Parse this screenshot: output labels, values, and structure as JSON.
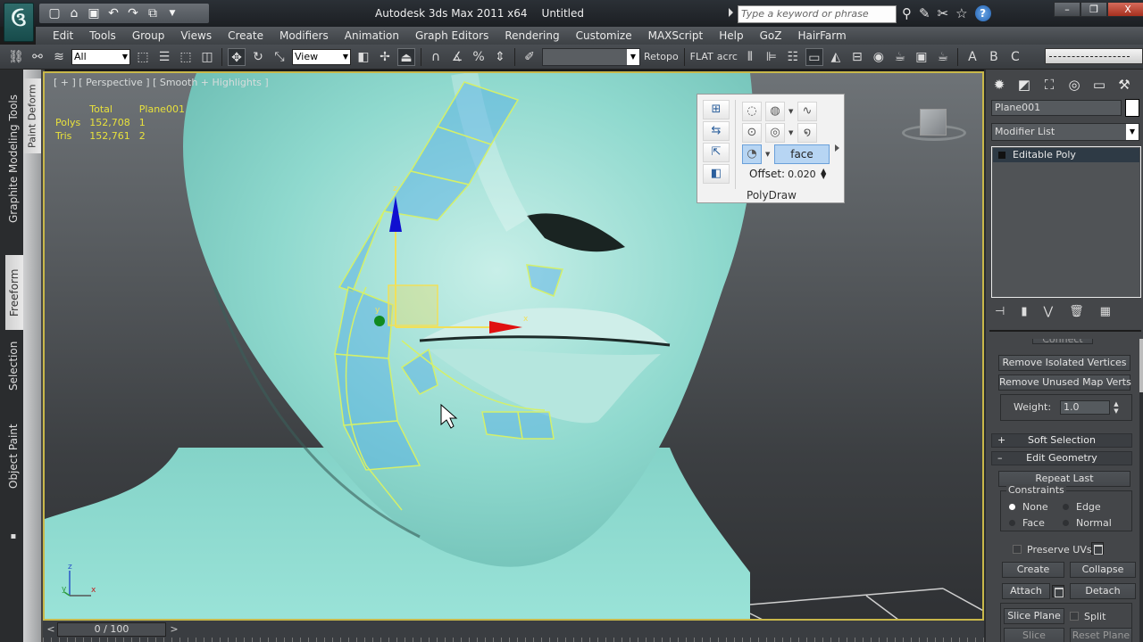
{
  "window": {
    "app_title": "Autodesk 3ds Max  2011 x64",
    "doc_title": "Untitled",
    "search_placeholder": "Type a keyword or phrase",
    "minimize": "–",
    "restore": "❐",
    "close": "X"
  },
  "quick_access": [
    "new-icon",
    "open-icon",
    "save-icon",
    "undo-icon",
    "redo-icon",
    "project-folder-icon"
  ],
  "menu": [
    "Edit",
    "Tools",
    "Group",
    "Views",
    "Create",
    "Modifiers",
    "Animation",
    "Graph Editors",
    "Rendering",
    "Customize",
    "MAXScript",
    "Help",
    "GoZ",
    "HairFarm"
  ],
  "toolbar": {
    "selection_filter": "All",
    "reference_coord": "View",
    "retopo_label": "Retopo",
    "flat_label": "FLAT",
    "acrc_label": "acrc"
  },
  "ribbon": {
    "tabs": [
      "Graphite Modeling Tools",
      "Freeform",
      "Selection",
      "Object Paint"
    ],
    "active_tab": "Freeform",
    "panel_tab": "Paint Deform"
  },
  "viewport": {
    "label": "[ + ] [ Perspective ] [ Smooth + Highlights ]",
    "stats": {
      "col_total": "Total",
      "col_object": "Plane001",
      "rows": [
        {
          "label": "Polys",
          "total": "152,708",
          "object": "1"
        },
        {
          "label": "Tris",
          "total": "152,761",
          "object": "2"
        }
      ]
    },
    "gizmo_axis_x": "x",
    "gizmo_axis_y": "y",
    "gizmo_axis_z": "z",
    "tripod": {
      "z": "z",
      "y": "y",
      "x": "x"
    }
  },
  "polydraw": {
    "title": "PolyDraw",
    "mode_label": "face",
    "offset_label": "Offset:",
    "offset_value": "0.020"
  },
  "timeslider": {
    "frame": "0 / 100",
    "prev": "<",
    "next": ">"
  },
  "command_panel": {
    "tabs": [
      "create-icon",
      "modify-icon",
      "hierarchy-icon",
      "motion-icon",
      "display-icon",
      "utilities-icon"
    ],
    "object_name": "Plane001",
    "modifier_list": "Modifier List",
    "stack_item": "Editable Poly",
    "rollout": {
      "connect": "Connect",
      "remove_isolated": "Remove Isolated Vertices",
      "remove_unused": "Remove Unused Map Verts",
      "weight_label": "Weight:",
      "weight_value": "1.0",
      "soft_selection": "Soft Selection",
      "edit_geometry": "Edit Geometry",
      "repeat_last": "Repeat Last",
      "constraints_title": "Constraints",
      "constraint_none": "None",
      "constraint_edge": "Edge",
      "constraint_face": "Face",
      "constraint_normal": "Normal",
      "preserve_uvs": "Preserve UVs",
      "create": "Create",
      "collapse": "Collapse",
      "attach": "Attach",
      "detach": "Detach",
      "slice_plane": "Slice Plane",
      "split": "Split",
      "slice": "Slice",
      "reset_plane": "Reset Plane"
    }
  }
}
